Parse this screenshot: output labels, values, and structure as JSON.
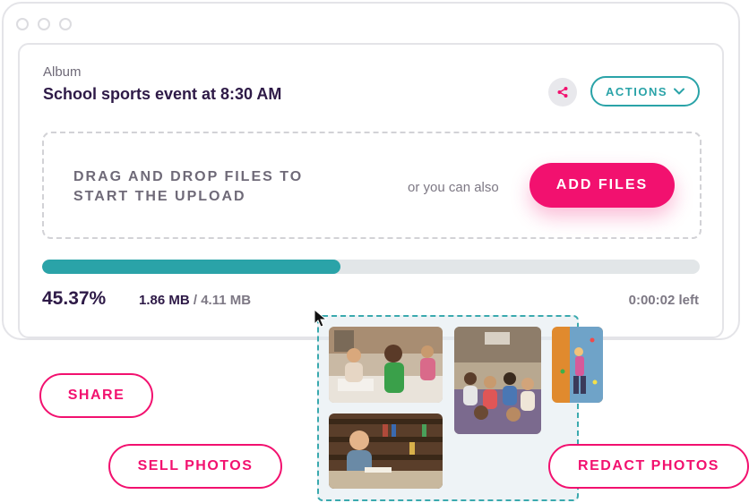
{
  "album": {
    "label": "Album",
    "title": "School sports event at 8:30 AM"
  },
  "header": {
    "actions_label": "ACTIONS"
  },
  "upload": {
    "drop_text": "DRAG AND DROP FILES TO START THE UPLOAD",
    "or_text": "or you can also",
    "add_files_label": "ADD FILES"
  },
  "progress": {
    "fraction": 0.4537,
    "percent_text": "45.37%",
    "uploaded": "1.86 MB",
    "separator": " / ",
    "total": "4.11 MB",
    "time_left": "0:00:02 left"
  },
  "actions": {
    "share_label": "SHARE",
    "sell_label": "SELL PHOTOS",
    "redact_label": "REDACT PHOTOS"
  },
  "colors": {
    "accent_pink": "#f2116f",
    "accent_teal": "#2aa3a8",
    "text_dark": "#2e1a47"
  },
  "icons": [
    "share-icon",
    "chevron-down-icon",
    "mouse-cursor-icon"
  ]
}
